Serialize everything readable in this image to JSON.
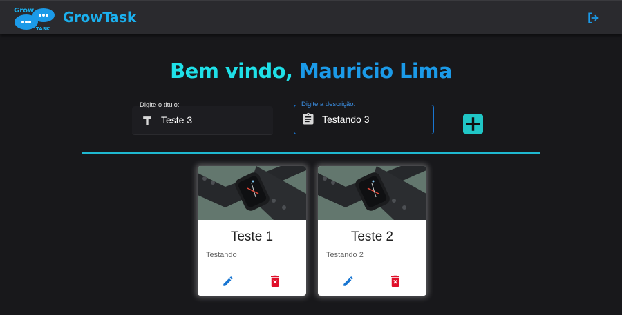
{
  "header": {
    "logo_text_top": "Grow",
    "logo_text_bottom": "TASK",
    "brand": "GrowTask",
    "brand_color": "#1bb0ee",
    "logout_icon": "logout-icon"
  },
  "welcome": {
    "prefix": "Bem vindo, ",
    "name": "Mauricio Lima",
    "prefix_color": "#1fe0e8",
    "name_color": "#1b9ae8"
  },
  "form": {
    "title_label": "Digite o titulo:",
    "title_value": "Teste 3",
    "title_icon": "text-format-icon",
    "desc_label": "Digite a descrição:",
    "desc_value": "Testando 3",
    "desc_icon": "clipboard-icon",
    "add_icon": "plus-icon",
    "accent": "#20c6c6"
  },
  "tasks": [
    {
      "title": "Teste 1",
      "description": "Testando"
    },
    {
      "title": "Teste 2",
      "description": "Testando 2"
    }
  ],
  "colors": {
    "background": "#18181b",
    "topbar": "#2a2a2e",
    "edit": "#1976d2",
    "delete": "#e0102a"
  }
}
